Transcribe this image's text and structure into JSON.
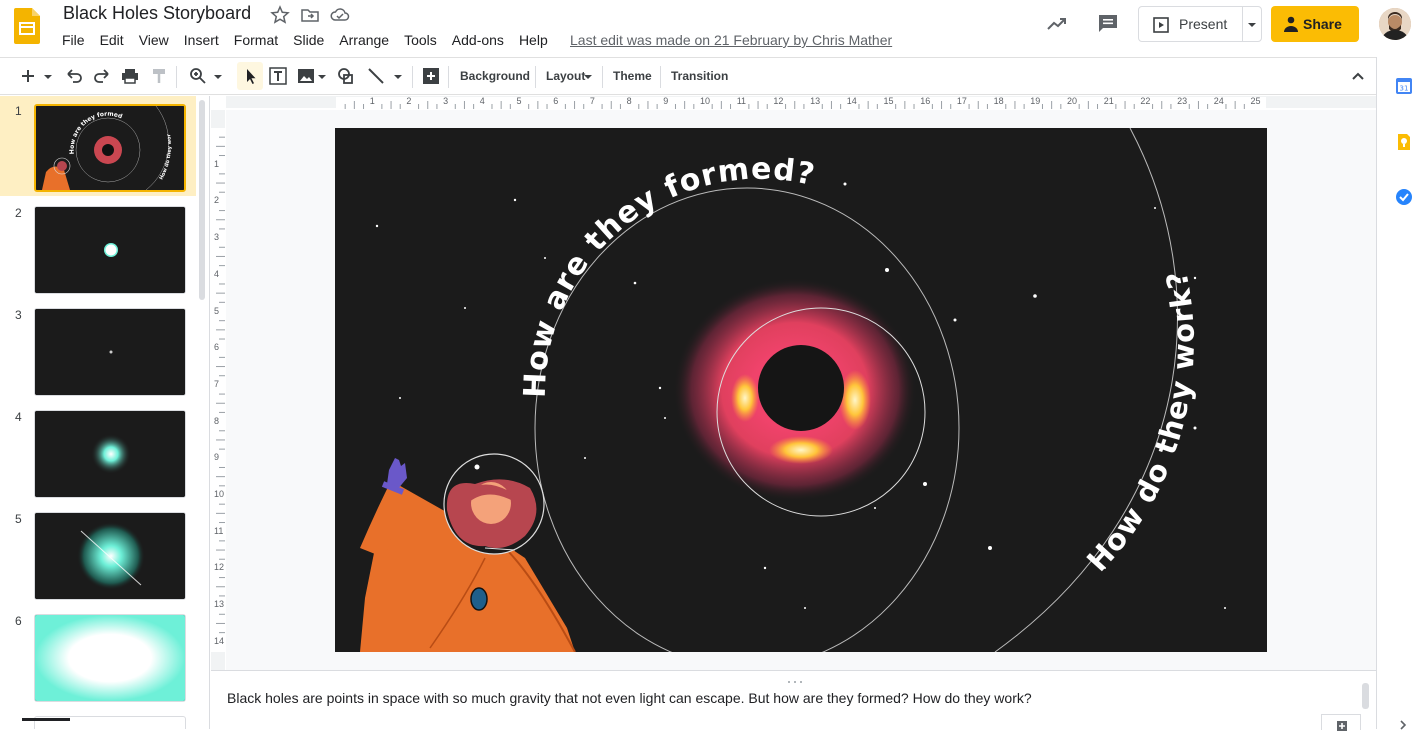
{
  "doc": {
    "title": "Black Holes Storyboard",
    "last_edit": "Last edit was made on 21 February by Chris Mather"
  },
  "menus": [
    "File",
    "Edit",
    "View",
    "Insert",
    "Format",
    "Slide",
    "Arrange",
    "Tools",
    "Add-ons",
    "Help"
  ],
  "header": {
    "present_label": "Present",
    "share_label": "Share"
  },
  "toolbar": {
    "background_label": "Background",
    "layout_label": "Layout",
    "theme_label": "Theme",
    "transition_label": "Transition"
  },
  "ruler": {
    "horizontal_ticks": [
      "1",
      "2",
      "3",
      "4",
      "5",
      "6",
      "7",
      "8",
      "9",
      "10",
      "11",
      "12",
      "13",
      "14",
      "15",
      "16",
      "17",
      "18",
      "19",
      "20",
      "21",
      "22",
      "23",
      "24",
      "25"
    ],
    "vertical_ticks": [
      "1",
      "2",
      "3",
      "4",
      "5",
      "6",
      "7",
      "8",
      "9",
      "10",
      "11",
      "12",
      "13",
      "14"
    ]
  },
  "slides": [
    {
      "num": "1",
      "selected": true
    },
    {
      "num": "2"
    },
    {
      "num": "3"
    },
    {
      "num": "4"
    },
    {
      "num": "5"
    },
    {
      "num": "6"
    }
  ],
  "slide_content": {
    "arc_text_1": "How are they formed?",
    "arc_text_2": "How do they work?"
  },
  "thumb_text": {
    "arc_1": "How are they formed?",
    "arc_2": "How do they work?"
  },
  "notes": {
    "text": "Black holes are points in space with so much gravity that not even light can escape. But how are they formed? How do they work?"
  },
  "colors": {
    "accent": "#fbbc04",
    "selected_slide_bg": "#feefc3",
    "selection_border": "#f4b400"
  }
}
